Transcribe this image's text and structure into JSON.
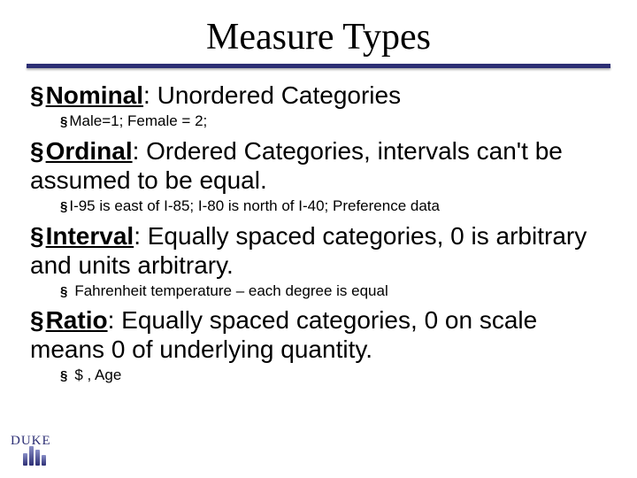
{
  "title": "Measure Types",
  "items": [
    {
      "term": "Nominal",
      "desc": ": Unordered Categories",
      "sub": "Male=1; Female = 2;",
      "sub_loose": false
    },
    {
      "term": "Ordinal",
      "desc": ": Ordered Categories, intervals can't be assumed to be equal.",
      "sub": "I-95 is east of I-85;  I-80 is north of I-40; Preference data",
      "sub_loose": false
    },
    {
      "term": "Interval",
      "desc": ": Equally spaced categories, 0 is arbitrary and units arbitrary.",
      "sub": "Fahrenheit temperature – each degree is equal",
      "sub_loose": true
    },
    {
      "term": "Ratio",
      "desc": ": Equally spaced categories, 0 on scale means 0 of underlying quantity.",
      "sub": "$ , Age",
      "sub_loose": true
    }
  ],
  "logo_text": "DUKE"
}
